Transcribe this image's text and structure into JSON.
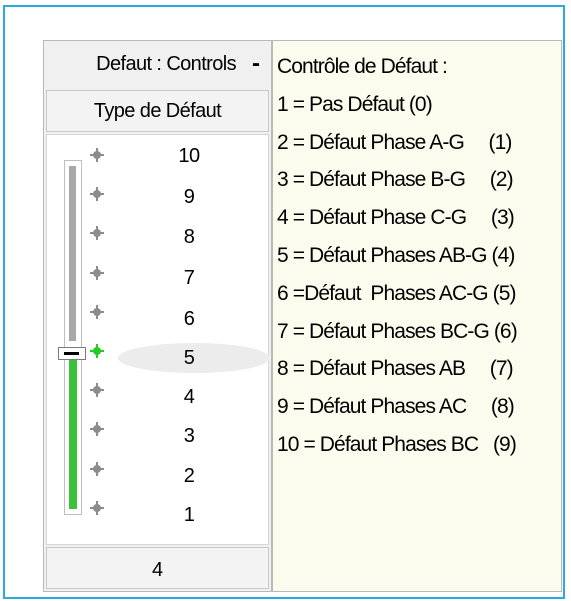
{
  "panel": {
    "title": "Defaut : Controls",
    "minimize_label": "-",
    "column_header": "Type de Défaut",
    "slider": {
      "ticks": [
        "10",
        "9",
        "8",
        "7",
        "6",
        "5",
        "4",
        "3",
        "2",
        "1"
      ],
      "selected": "5",
      "fill_fraction": 0.44
    },
    "value": "4"
  },
  "legend": {
    "lines": [
      "Contrôle de Défaut :",
      "1 = Pas Défaut (0)",
      "2 = Défaut Phase A-G     (1)",
      "3 = Défaut Phase B-G     (2)",
      "4 = Défaut Phase C-G     (3)",
      "5 = Défaut Phases AB-G (4)",
      "6 =Défaut  Phases AC-G (5)",
      "7 = Défaut Phases BC-G (6)",
      "8 = Défaut Phases AB     (7)",
      "9 = Défaut Phases AC     (8)",
      "10 = Défaut Phases BC   (9)"
    ]
  },
  "colors": {
    "frame": "#2fa8e0",
    "slider_fill": "#3cc13c",
    "active_dot": "#22cc22",
    "legend_background": "#fcfcee"
  }
}
